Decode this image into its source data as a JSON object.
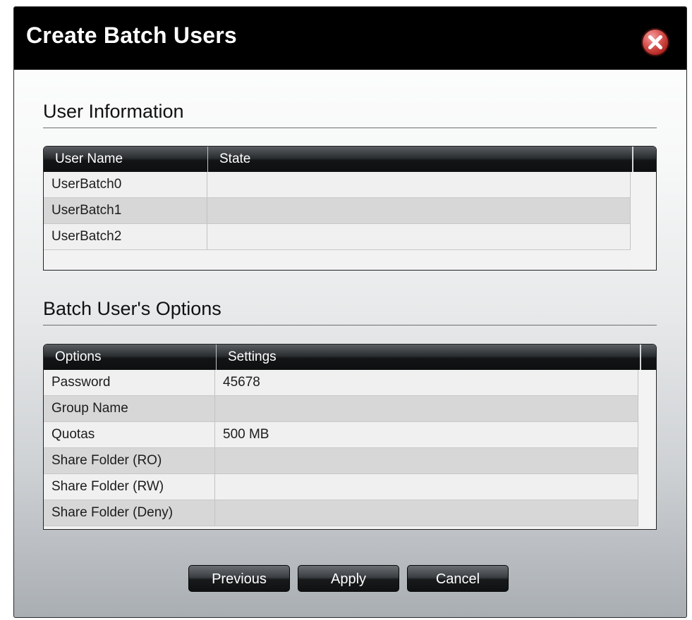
{
  "dialog": {
    "title": "Create Batch Users"
  },
  "user_info": {
    "section_title": "User Information",
    "columns": [
      "User Name",
      "State"
    ],
    "rows": [
      {
        "user_name": "UserBatch0",
        "state": ""
      },
      {
        "user_name": "UserBatch1",
        "state": ""
      },
      {
        "user_name": "UserBatch2",
        "state": ""
      }
    ]
  },
  "options": {
    "section_title": "Batch User's Options",
    "columns": [
      "Options",
      "Settings"
    ],
    "rows": [
      {
        "option": "Password",
        "setting": "45678"
      },
      {
        "option": "Group Name",
        "setting": ""
      },
      {
        "option": "Quotas",
        "setting": "500 MB"
      },
      {
        "option": "Share Folder (RO)",
        "setting": ""
      },
      {
        "option": "Share Folder (RW)",
        "setting": ""
      },
      {
        "option": "Share Folder (Deny)",
        "setting": ""
      }
    ]
  },
  "buttons": {
    "previous": "Previous",
    "apply": "Apply",
    "cancel": "Cancel"
  },
  "icons": {
    "close": "close-icon"
  },
  "colors": {
    "titlebar": "#000000",
    "close_button": "#c0302b",
    "row_light": "#f0f0f0",
    "row_dark": "#d7d7d7"
  }
}
